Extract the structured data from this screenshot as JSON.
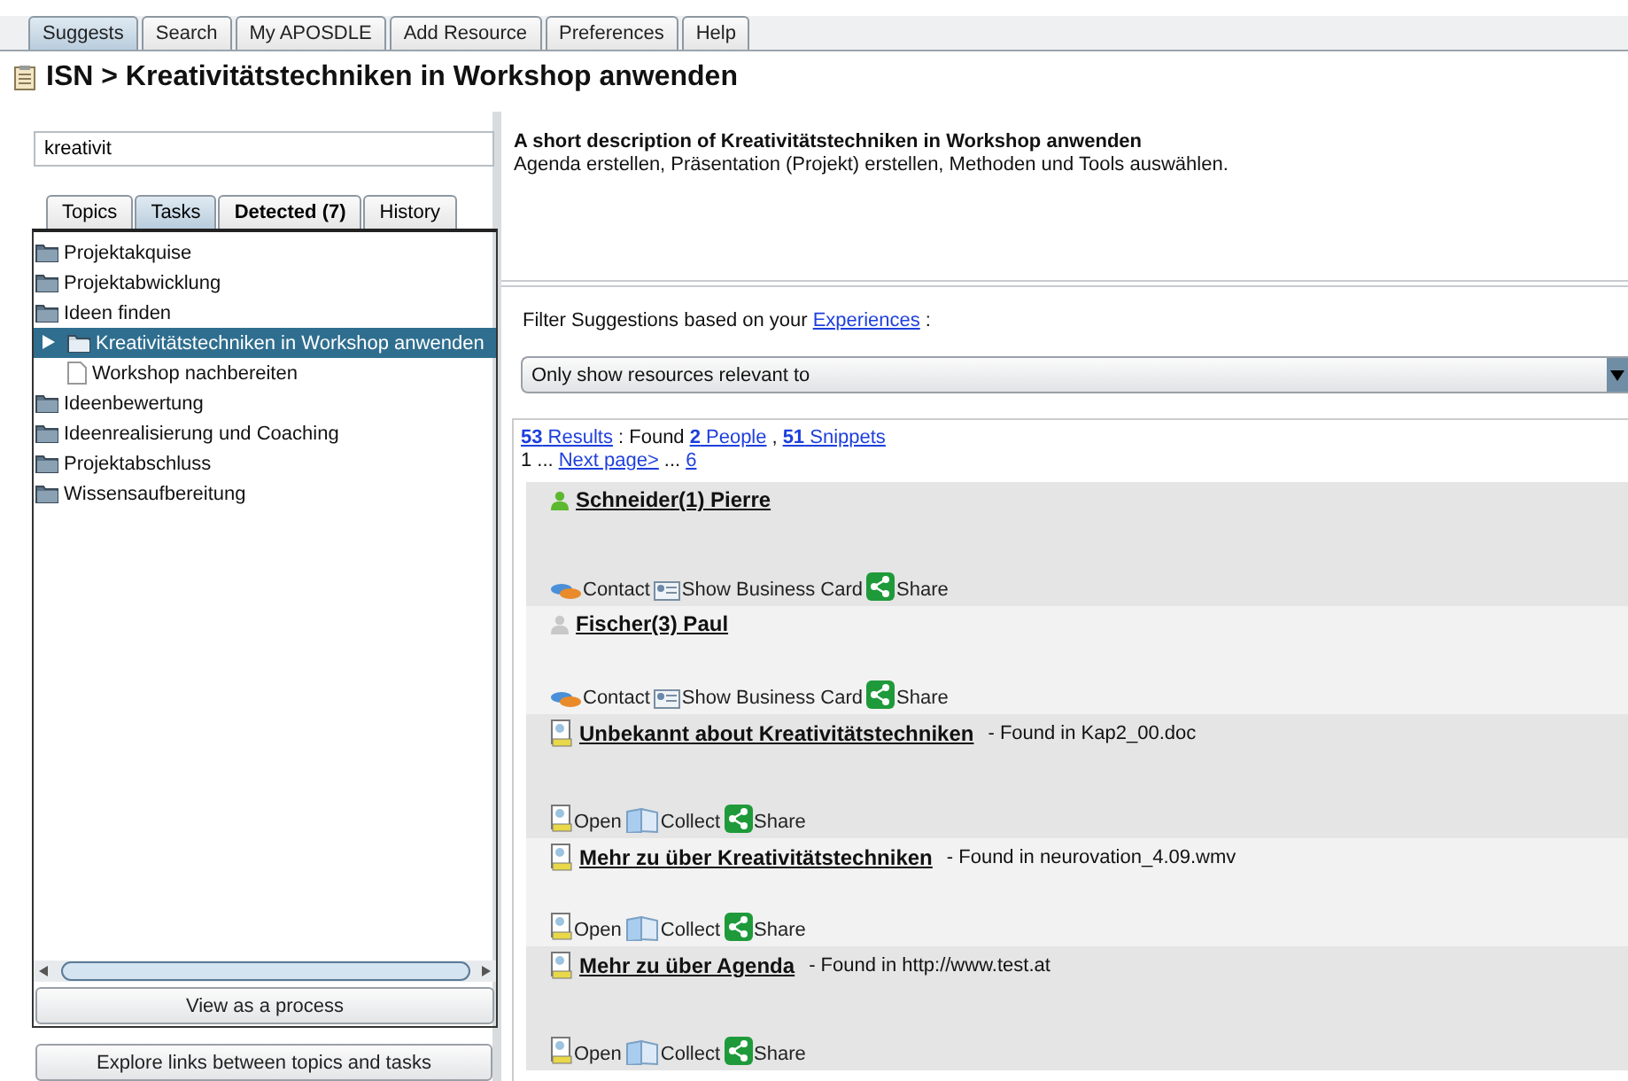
{
  "main_tabs": [
    {
      "label": "Suggests",
      "selected": true
    },
    {
      "label": "Search",
      "selected": false
    },
    {
      "label": "My APOSDLE",
      "selected": false
    },
    {
      "label": "Add Resource",
      "selected": false
    },
    {
      "label": "Preferences",
      "selected": false
    },
    {
      "label": "Help",
      "selected": false
    }
  ],
  "title": "ISN > Kreativitätstechniken in Workshop anwenden",
  "search": {
    "value": "kreativit"
  },
  "side_tabs": [
    {
      "label": "Topics",
      "selected": false,
      "bold": false
    },
    {
      "label": "Tasks",
      "selected": true,
      "bold": false
    },
    {
      "label": "Detected (7)",
      "selected": false,
      "bold": true
    },
    {
      "label": "History",
      "selected": false,
      "bold": false
    }
  ],
  "tree": [
    {
      "label": "Projektakquise",
      "kind": "folder",
      "selected": false
    },
    {
      "label": "Projektabwicklung",
      "kind": "folder",
      "selected": false
    },
    {
      "label": "Ideen finden",
      "kind": "folder",
      "selected": false,
      "children": [
        {
          "label": "Kreativitätstechniken in Workshop anwenden",
          "kind": "folder",
          "selected": true,
          "expanded": false
        },
        {
          "label": "Workshop nachbereiten",
          "kind": "task",
          "selected": false
        }
      ]
    },
    {
      "label": "Ideenbewertung",
      "kind": "folder",
      "selected": false
    },
    {
      "label": "Ideenrealisierung und Coaching",
      "kind": "folder",
      "selected": false
    },
    {
      "label": "Projektabschluss",
      "kind": "folder",
      "selected": false
    },
    {
      "label": "Wissensaufbereitung",
      "kind": "folder",
      "selected": false
    }
  ],
  "tree_buttons": [
    "View as a process"
  ],
  "side_buttons": [
    "Explore links between topics and tasks"
  ],
  "description": {
    "heading": "A short description of Kreativitätstechniken in Workshop anwenden",
    "text": "Agenda erstellen, Präsentation (Projekt) erstellen, Methoden und Tools auswählen."
  },
  "filter": {
    "text": "Filter Suggestions based on your",
    "link": "Experiences",
    "suffix": ":",
    "dropdown": "Only show resources relevant to"
  },
  "summary": {
    "results_link": "**53** Results",
    "found_text": ": Found",
    "people_link": "**2** People",
    "separator": ",",
    "snippets_link": "**51** Snippets",
    "page_text": "1 ...",
    "next_link": "Next page>",
    "ellipsis": "...",
    "last_link": "6"
  },
  "results": [
    {
      "kind": "person",
      "title": "Schneider(1) Pierre",
      "online": true,
      "actions": [
        {
          "kind": "contact",
          "label": "Contact"
        },
        {
          "kind": "card",
          "label": "Show Business Card"
        },
        {
          "kind": "share",
          "label": "Share"
        }
      ]
    },
    {
      "kind": "person",
      "title": "Fischer(3) Paul",
      "online": false,
      "actions": [
        {
          "kind": "contact",
          "label": "Contact"
        },
        {
          "kind": "card",
          "label": "Show Business Card"
        },
        {
          "kind": "share",
          "label": "Share"
        }
      ]
    },
    {
      "kind": "document",
      "title": "Unbekannt about Kreativitätstechniken",
      "source": "- Found in Kap2_00.doc",
      "actions": [
        {
          "kind": "open",
          "label": "Open"
        },
        {
          "kind": "collect",
          "label": "Collect"
        },
        {
          "kind": "share",
          "label": "Share"
        }
      ]
    },
    {
      "kind": "document",
      "title": "Mehr zu über Kreativitätstechniken",
      "source": "- Found in neurovation_4.09.wmv",
      "actions": [
        {
          "kind": "open",
          "label": "Open"
        },
        {
          "kind": "collect",
          "label": "Collect"
        },
        {
          "kind": "share",
          "label": "Share"
        }
      ]
    },
    {
      "kind": "document",
      "title": "Mehr zu über Agenda",
      "source": "- Found in http://www.test.at",
      "actions": [
        {
          "kind": "open",
          "label": "Open"
        },
        {
          "kind": "collect",
          "label": "Collect"
        },
        {
          "kind": "share",
          "label": "Share"
        }
      ]
    }
  ]
}
